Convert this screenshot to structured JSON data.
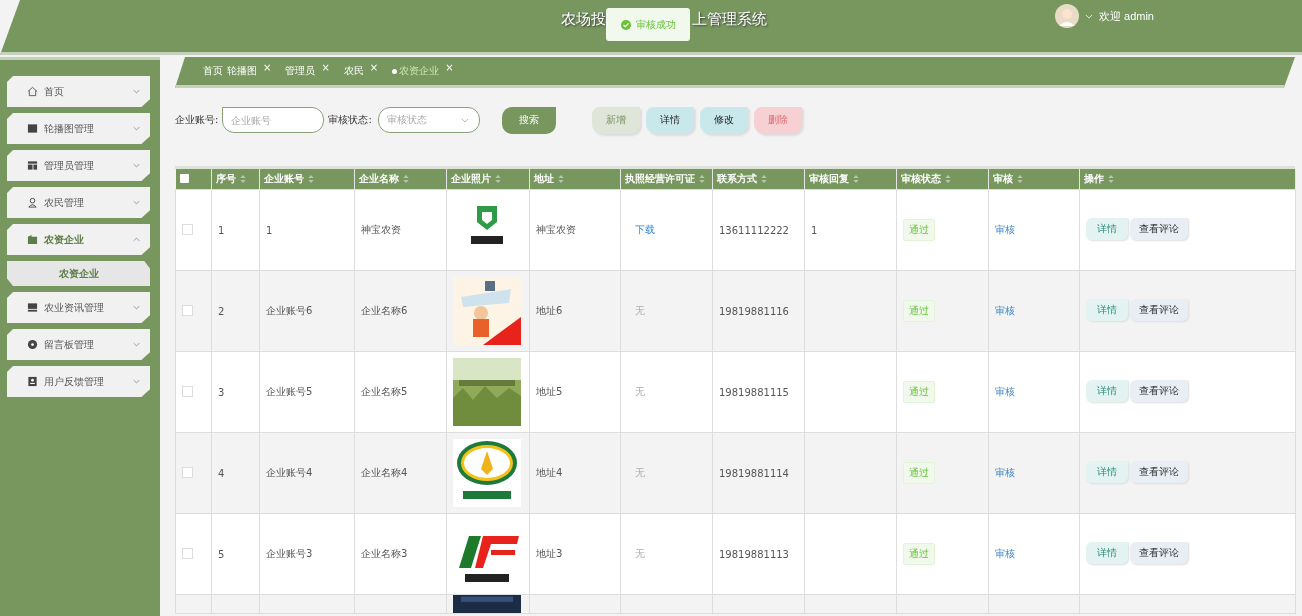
{
  "header": {
    "title_left": "农场投",
    "title_right": "上管理系统",
    "user": "欢迎 admin"
  },
  "toast": {
    "text": "审核成功"
  },
  "sidebar": {
    "items": [
      {
        "label": "首页",
        "expanded": false
      },
      {
        "label": "轮播图管理",
        "expanded": false
      },
      {
        "label": "管理员管理",
        "expanded": false
      },
      {
        "label": "农民管理",
        "expanded": false
      },
      {
        "label": "农资企业",
        "expanded": true,
        "children": [
          {
            "label": "农资企业",
            "selected": true
          }
        ]
      },
      {
        "label": "农业资讯管理",
        "expanded": false
      },
      {
        "label": "留言板管理",
        "expanded": false
      },
      {
        "label": "用户反馈管理",
        "expanded": false
      }
    ]
  },
  "tabs": [
    {
      "label": "首页",
      "selected": false
    },
    {
      "label": "轮播图",
      "close": "×",
      "selected": false
    },
    {
      "label": "管理员",
      "close": "×",
      "selected": false
    },
    {
      "label": "农民",
      "close": "×",
      "selected": false
    },
    {
      "label": "农资企业",
      "close": "×",
      "selected": true
    }
  ],
  "search": {
    "account_label": "企业账号:",
    "account_placeholder": "企业账号",
    "status_label": "审核状态:",
    "status_placeholder": "审核状态",
    "button": "搜索"
  },
  "actions": [
    {
      "kind": "add",
      "label": "新增"
    },
    {
      "kind": "info",
      "label": "详情"
    },
    {
      "kind": "info",
      "label": "修改"
    },
    {
      "kind": "danger",
      "label": "删除"
    }
  ],
  "table": {
    "select_all_checked": false,
    "columns": [
      "序号",
      "企业账号",
      "企业名称",
      "企业照片",
      "地址",
      "执照经营许可证",
      "联系方式",
      "审核回复",
      "审核状态",
      "审核",
      "操作"
    ],
    "rows": [
      {
        "checked": false,
        "index": "1",
        "account": "1",
        "name": "神宝农资",
        "address": "神宝农资",
        "license": {
          "kind": "link",
          "text": "下载"
        },
        "phone": "13611112222",
        "reply": "1",
        "status": "通过",
        "audit": "审核",
        "buttons": [
          "详情",
          "查看评论"
        ]
      },
      {
        "checked": false,
        "index": "2",
        "account": "企业账号6",
        "name": "企业名称6",
        "address": "地址6",
        "license": {
          "kind": "none",
          "text": "无"
        },
        "phone": "19819881116",
        "status": "通过",
        "audit": "审核",
        "buttons": [
          "详情",
          "查看评论"
        ]
      },
      {
        "checked": false,
        "index": "3",
        "account": "企业账号5",
        "name": "企业名称5",
        "address": "地址5",
        "license": {
          "kind": "none",
          "text": "无"
        },
        "phone": "19819881115",
        "status": "通过",
        "audit": "审核",
        "buttons": [
          "详情",
          "查看评论"
        ]
      },
      {
        "checked": false,
        "index": "4",
        "account": "企业账号4",
        "name": "企业名称4",
        "address": "地址4",
        "license": {
          "kind": "none",
          "text": "无"
        },
        "phone": "19819881114",
        "status": "通过",
        "audit": "审核",
        "buttons": [
          "详情",
          "查看评论"
        ]
      },
      {
        "checked": false,
        "index": "5",
        "account": "企业账号3",
        "name": "企业名称3",
        "address": "地址3",
        "license": {
          "kind": "none",
          "text": "无"
        },
        "phone": "19819881113",
        "status": "通过",
        "audit": "审核",
        "buttons": [
          "详情",
          "查看评论"
        ]
      }
    ]
  }
}
